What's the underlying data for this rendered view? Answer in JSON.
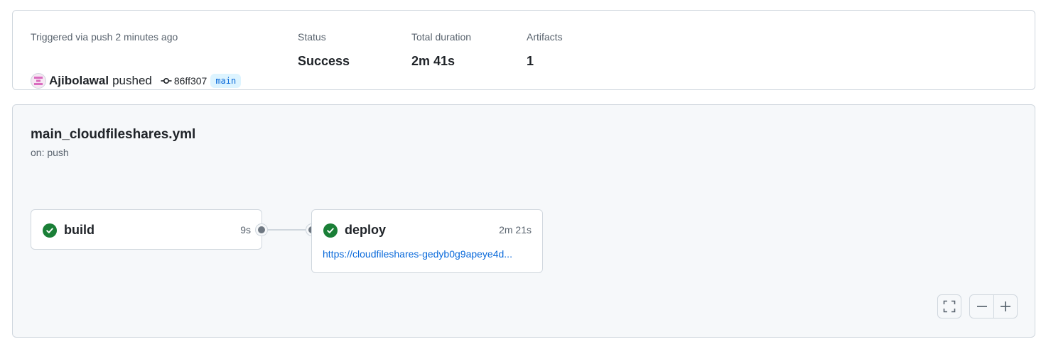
{
  "summary": {
    "trigger_label": "Triggered via push 2 minutes ago",
    "actor": "Ajibolawal",
    "action": "pushed",
    "commit_sha": "86ff307",
    "branch": "main",
    "status_label": "Status",
    "status_value": "Success",
    "duration_label": "Total duration",
    "duration_value": "2m 41s",
    "artifacts_label": "Artifacts",
    "artifacts_value": "1"
  },
  "workflow": {
    "file_name": "main_cloudfileshares.yml",
    "trigger": "on: push",
    "jobs": [
      {
        "name": "build",
        "duration": "9s",
        "status": "success"
      },
      {
        "name": "deploy",
        "duration": "2m 21s",
        "status": "success",
        "url": "https://cloudfileshares-gedyb0g9apeye4d..."
      }
    ]
  },
  "controls": {
    "fullscreen_icon": "fullscreen-icon",
    "zoom_out_icon": "minus-icon",
    "zoom_in_icon": "plus-icon"
  },
  "colors": {
    "success": "#1a7f37",
    "link": "#0969da",
    "branch_bg": "#ddf4ff"
  }
}
